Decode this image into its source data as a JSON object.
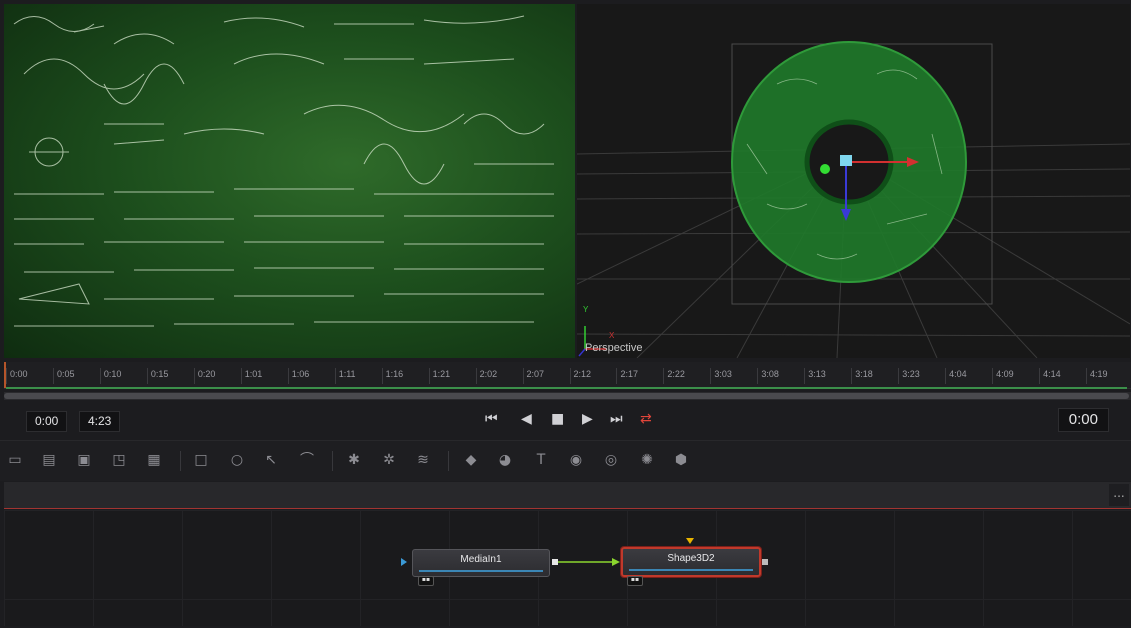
{
  "viewer_right": {
    "label": "Perspective",
    "axis_y": "Y",
    "axis_x": "X"
  },
  "ruler": {
    "ticks": [
      "0:00",
      "0:05",
      "0:10",
      "0:15",
      "0:20",
      "1:01",
      "1:06",
      "1:11",
      "1:16",
      "1:21",
      "2:02",
      "2:07",
      "2:12",
      "2:17",
      "2:22",
      "3:03",
      "3:08",
      "3:13",
      "3:18",
      "3:23",
      "4:04",
      "4:09",
      "4:14",
      "4:19"
    ]
  },
  "transport": {
    "start": "0:00",
    "end": "4:23",
    "current": "0:00"
  },
  "nodes": {
    "media_in": "MediaIn1",
    "shape3d": "Shape3D2"
  },
  "subbar": {
    "more": "..."
  }
}
